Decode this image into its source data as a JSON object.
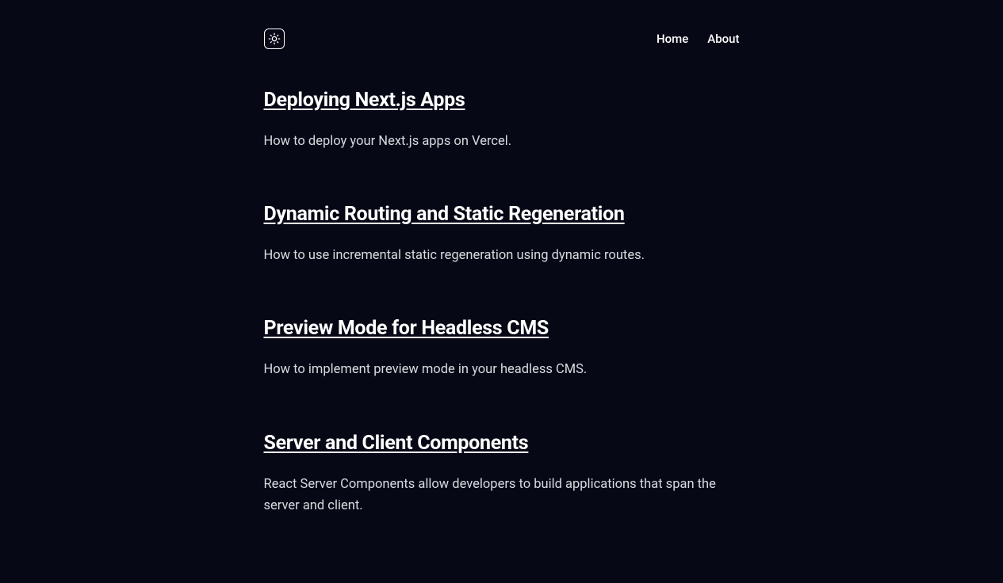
{
  "nav": {
    "home": "Home",
    "about": "About"
  },
  "posts": [
    {
      "title": "Deploying Next.js Apps",
      "description": "How to deploy your Next.js apps on Vercel."
    },
    {
      "title": "Dynamic Routing and Static Regeneration",
      "description": "How to use incremental static regeneration using dynamic routes."
    },
    {
      "title": "Preview Mode for Headless CMS",
      "description": "How to implement preview mode in your headless CMS."
    },
    {
      "title": "Server and Client Components",
      "description": "React Server Components allow developers to build applications that span the server and client."
    }
  ]
}
